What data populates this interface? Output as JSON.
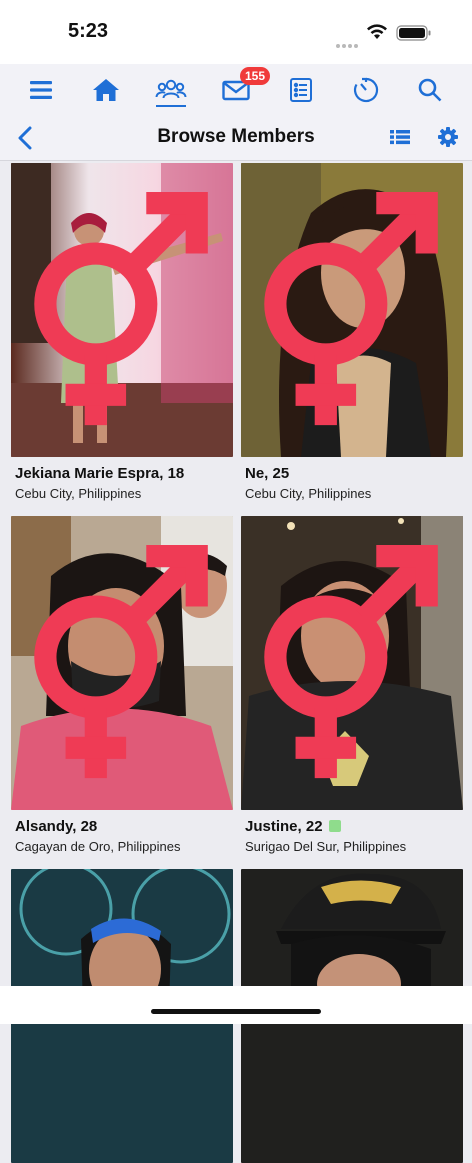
{
  "status": {
    "time": "5:23"
  },
  "nav": {
    "messages_badge": "155"
  },
  "header": {
    "title": "Browse Members"
  },
  "members": [
    {
      "name": "Jekiana Marie Espra, 18",
      "location": "Cebu City, Philippines"
    },
    {
      "name": "Ne, 25",
      "location": "Cebu City, Philippines"
    },
    {
      "name": "Alsandy, 28",
      "location": "Cagayan de Oro, Philippines"
    },
    {
      "name": "Justine, 22",
      "location": "Surigao Del Sur, Philippines",
      "online": true
    }
  ],
  "icons": {
    "nav": [
      "menu-icon",
      "home-icon",
      "members-icon",
      "messages-icon",
      "list-icon",
      "activity-icon",
      "search-icon"
    ],
    "header": [
      "back-icon",
      "list-view-icon",
      "settings-icon"
    ],
    "card": "transgender-icon"
  },
  "colors": {
    "accent": "#1f6fd6",
    "badge": "#f03a3a",
    "gender_symbol": "#ef3b55",
    "online": "#8fdc8c"
  }
}
